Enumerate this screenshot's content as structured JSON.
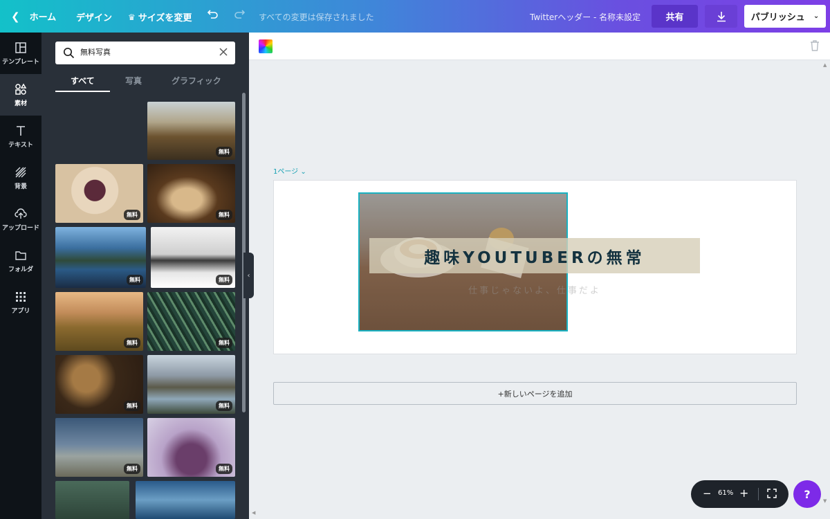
{
  "topbar": {
    "home_label": "ホーム",
    "design_label": "デザイン",
    "resize_label": "サイズを変更",
    "save_status": "すべての変更は保存されました",
    "doc_title": "Twitterヘッダー - 名称未設定",
    "share_label": "共有",
    "publish_label": "パブリッシュ"
  },
  "rail": {
    "items": [
      {
        "label": "テンプレート",
        "icon": "layout-icon"
      },
      {
        "label": "素材",
        "icon": "shapes-icon"
      },
      {
        "label": "テキスト",
        "icon": "text-icon"
      },
      {
        "label": "背景",
        "icon": "background-icon"
      },
      {
        "label": "アップロード",
        "icon": "upload-icon"
      },
      {
        "label": "フォルダ",
        "icon": "folder-icon"
      },
      {
        "label": "アプリ",
        "icon": "apps-icon"
      }
    ],
    "active_index": 1
  },
  "panel": {
    "search_value": "無料写真",
    "tabs": [
      "すべて",
      "写真",
      "グラフィック"
    ],
    "active_tab": 0,
    "badge_label": "無料"
  },
  "canvas": {
    "page_label": "1ページ",
    "title_text": "趣味YOUTUBERの無常",
    "subtitle_text": "仕事じゃないよ、仕事だよ",
    "add_page_label": "+新しいページを追加"
  },
  "zoom": {
    "value": "61%"
  },
  "help_label": "?",
  "colors": {
    "accent": "#19b2c2",
    "brand_purple": "#7d2ae8",
    "panel_bg": "#293039",
    "rail_bg": "#0e1318"
  }
}
